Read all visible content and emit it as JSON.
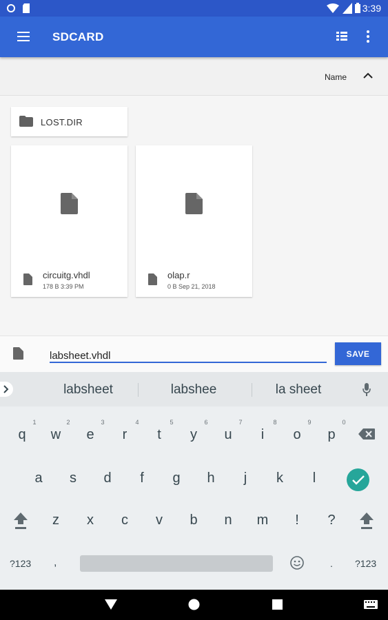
{
  "status_bar": {
    "time": "3:39"
  },
  "app_bar": {
    "title": "SDCARD",
    "icons": [
      "menu-icon",
      "list-view-icon",
      "more-vert-icon"
    ]
  },
  "sort": {
    "label": "Name",
    "direction_icon": "chevron-up-icon"
  },
  "folders": [
    {
      "name": "LOST.DIR"
    }
  ],
  "files": [
    {
      "name": "circuitg.vhdl",
      "meta": "178 B 3:39 PM"
    },
    {
      "name": "olap.r",
      "meta": "0 B Sep 21, 2018"
    }
  ],
  "save_bar": {
    "filename": "labsheet.vhdl",
    "button": "SAVE"
  },
  "keyboard": {
    "suggestions": [
      "labsheet",
      "labshee",
      "la sheet"
    ],
    "row1": [
      "q",
      "w",
      "e",
      "r",
      "t",
      "y",
      "u",
      "i",
      "o",
      "p"
    ],
    "row1_hints": [
      "1",
      "2",
      "3",
      "4",
      "5",
      "6",
      "7",
      "8",
      "9",
      "0"
    ],
    "row2": [
      "a",
      "s",
      "d",
      "f",
      "g",
      "h",
      "j",
      "k",
      "l"
    ],
    "row3": [
      "z",
      "x",
      "c",
      "v",
      "b",
      "n",
      "m",
      "!",
      "?"
    ],
    "symbols_key": "?123",
    "comma_key": ",",
    "period_key": "."
  }
}
